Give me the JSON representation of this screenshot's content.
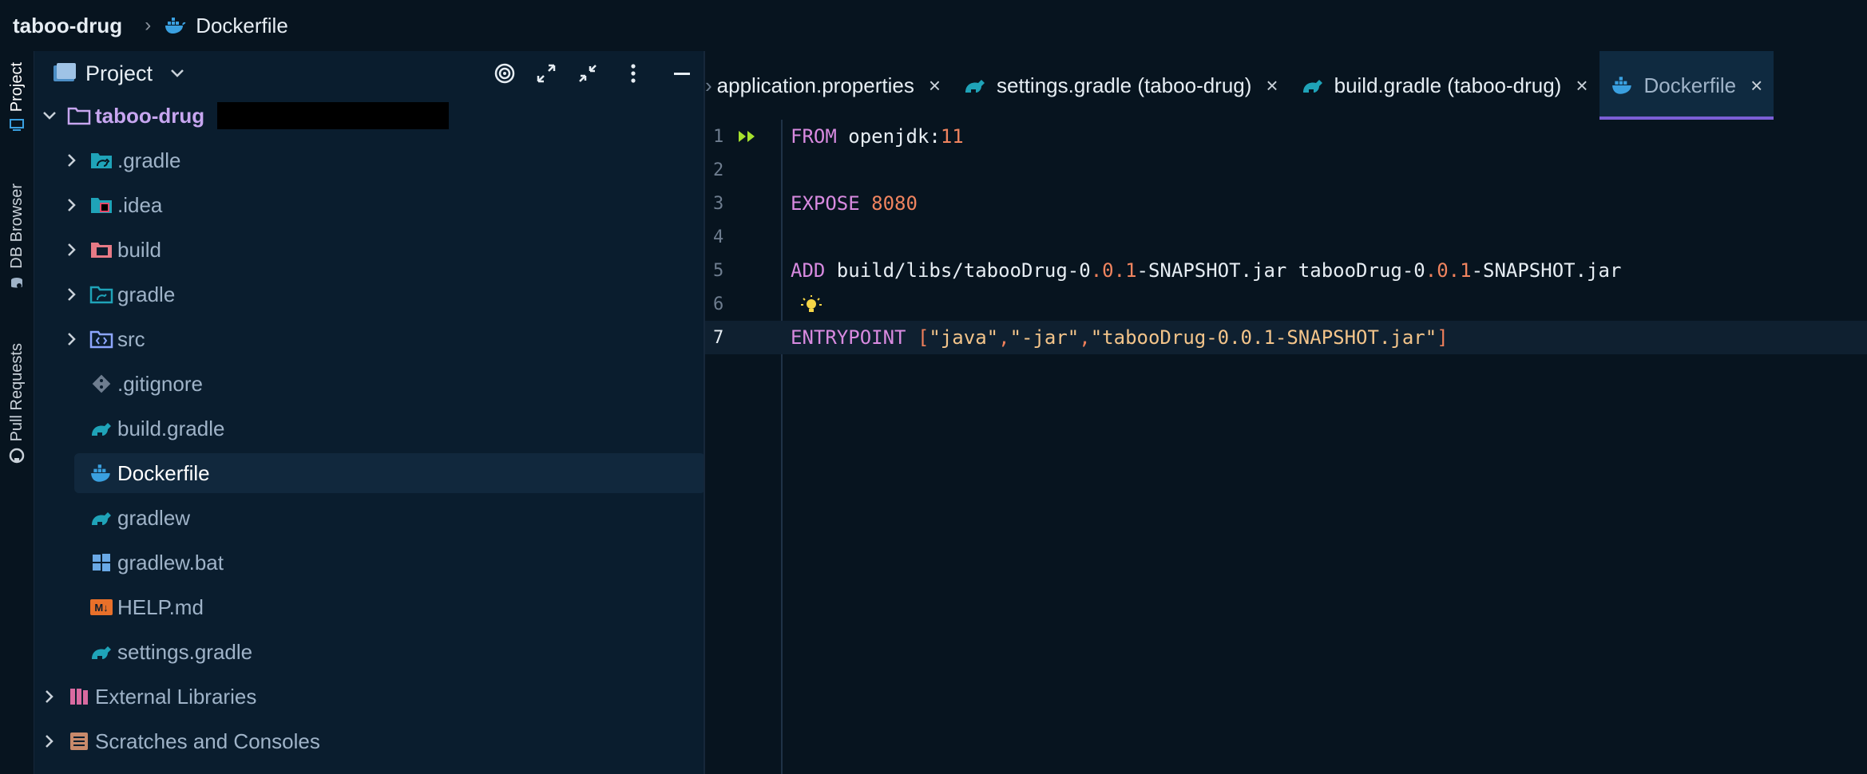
{
  "window": {
    "project_name": "taboo-drug",
    "breadcrumb_file": "Dockerfile"
  },
  "side_tabs": [
    "Project",
    "DB Browser",
    "Pull Requests"
  ],
  "panel": {
    "title": "Project"
  },
  "tree": {
    "root": "taboo-drug",
    "items": [
      {
        "label": ".gradle",
        "icon": "gradle-folder-icon",
        "expandable": true
      },
      {
        "label": ".idea",
        "icon": "idea-folder-icon",
        "expandable": true
      },
      {
        "label": "build",
        "icon": "build-folder-icon",
        "expandable": true
      },
      {
        "label": "gradle",
        "icon": "folder-icon",
        "expandable": true
      },
      {
        "label": "src",
        "icon": "source-folder-icon",
        "expandable": true
      },
      {
        "label": ".gitignore",
        "icon": "git-icon",
        "expandable": false
      },
      {
        "label": "build.gradle",
        "icon": "gradle-elephant-icon",
        "expandable": false
      },
      {
        "label": "Dockerfile",
        "icon": "docker-icon",
        "expandable": false,
        "selected": true
      },
      {
        "label": "gradlew",
        "icon": "gradle-elephant-icon",
        "expandable": false
      },
      {
        "label": "gradlew.bat",
        "icon": "windows-icon",
        "expandable": false
      },
      {
        "label": "HELP.md",
        "icon": "markdown-icon",
        "expandable": false
      },
      {
        "label": "settings.gradle",
        "icon": "gradle-elephant-icon",
        "expandable": false
      }
    ],
    "external_libraries": "External Libraries",
    "scratches": "Scratches and Consoles"
  },
  "tabs": [
    {
      "label": "application.properties",
      "icon": "",
      "active": false
    },
    {
      "label": "settings.gradle (taboo-drug)",
      "icon": "gradle-elephant-icon",
      "active": false
    },
    {
      "label": "build.gradle (taboo-drug)",
      "icon": "gradle-elephant-icon",
      "active": false
    },
    {
      "label": "Dockerfile",
      "icon": "docker-icon",
      "active": true
    }
  ],
  "code": {
    "current_line": 7,
    "lines": [
      {
        "n": "1",
        "tokens": [
          [
            "kw",
            "FROM"
          ],
          [
            "id",
            " openjdk:"
          ],
          [
            "num",
            "11"
          ]
        ]
      },
      {
        "n": "2",
        "tokens": []
      },
      {
        "n": "3",
        "tokens": [
          [
            "kw",
            "EXPOSE"
          ],
          [
            "id",
            " "
          ],
          [
            "num",
            "8080"
          ]
        ]
      },
      {
        "n": "4",
        "tokens": []
      },
      {
        "n": "5",
        "tokens": [
          [
            "kw",
            "ADD"
          ],
          [
            "id",
            " build/libs/tabooDrug-0"
          ],
          [
            "pun",
            "."
          ],
          [
            "num",
            "0"
          ],
          [
            "pun",
            "."
          ],
          [
            "num",
            "1"
          ],
          [
            "id",
            "-SNAPSHOT.jar tabooDrug-0"
          ],
          [
            "pun",
            "."
          ],
          [
            "num",
            "0"
          ],
          [
            "pun",
            "."
          ],
          [
            "num",
            "1"
          ],
          [
            "id",
            "-SNAPSHOT.jar"
          ]
        ]
      },
      {
        "n": "6",
        "tokens": []
      },
      {
        "n": "7",
        "tokens": [
          [
            "kw",
            "ENTRYPOINT"
          ],
          [
            "id",
            " "
          ],
          [
            "pun",
            "["
          ],
          [
            "str",
            "\"java\""
          ],
          [
            "pun",
            ","
          ],
          [
            "str",
            "\"-jar\""
          ],
          [
            "pun",
            ","
          ],
          [
            "str",
            "\"tabooDrug-0.0.1-SNAPSHOT.jar\""
          ],
          [
            "pun",
            "]"
          ]
        ]
      }
    ]
  },
  "colors": {
    "background": "#07141f",
    "panel": "#0a1d2e",
    "keyword": "#d88ae0",
    "number": "#f0845f",
    "string": "#f3c48a",
    "accent": "#7b5fd6"
  }
}
